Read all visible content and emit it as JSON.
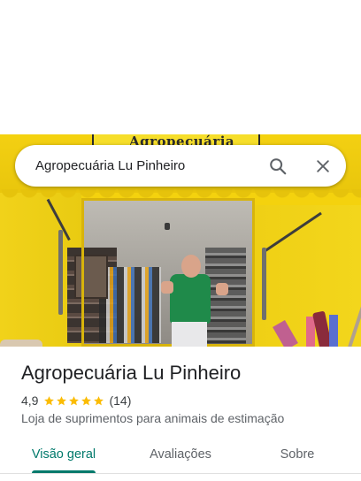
{
  "search": {
    "query": "Agropecuária Lu Pinheiro"
  },
  "photo": {
    "sign_text": "Agropecuária"
  },
  "place": {
    "name": "Agropecuária Lu Pinheiro",
    "rating": "4,9",
    "stars": 5,
    "review_count": "(14)",
    "category": "Loja de suprimentos para animais de estimação"
  },
  "tabs": [
    {
      "label": "Visão geral",
      "active": true
    },
    {
      "label": "Avaliações",
      "active": false
    },
    {
      "label": "Sobre",
      "active": false
    }
  ],
  "colors": {
    "accent": "#00796b",
    "star": "#fbbc04",
    "awning_yellow": "#f4d20e"
  },
  "icons": [
    "search-icon",
    "close-icon",
    "star-icon"
  ]
}
